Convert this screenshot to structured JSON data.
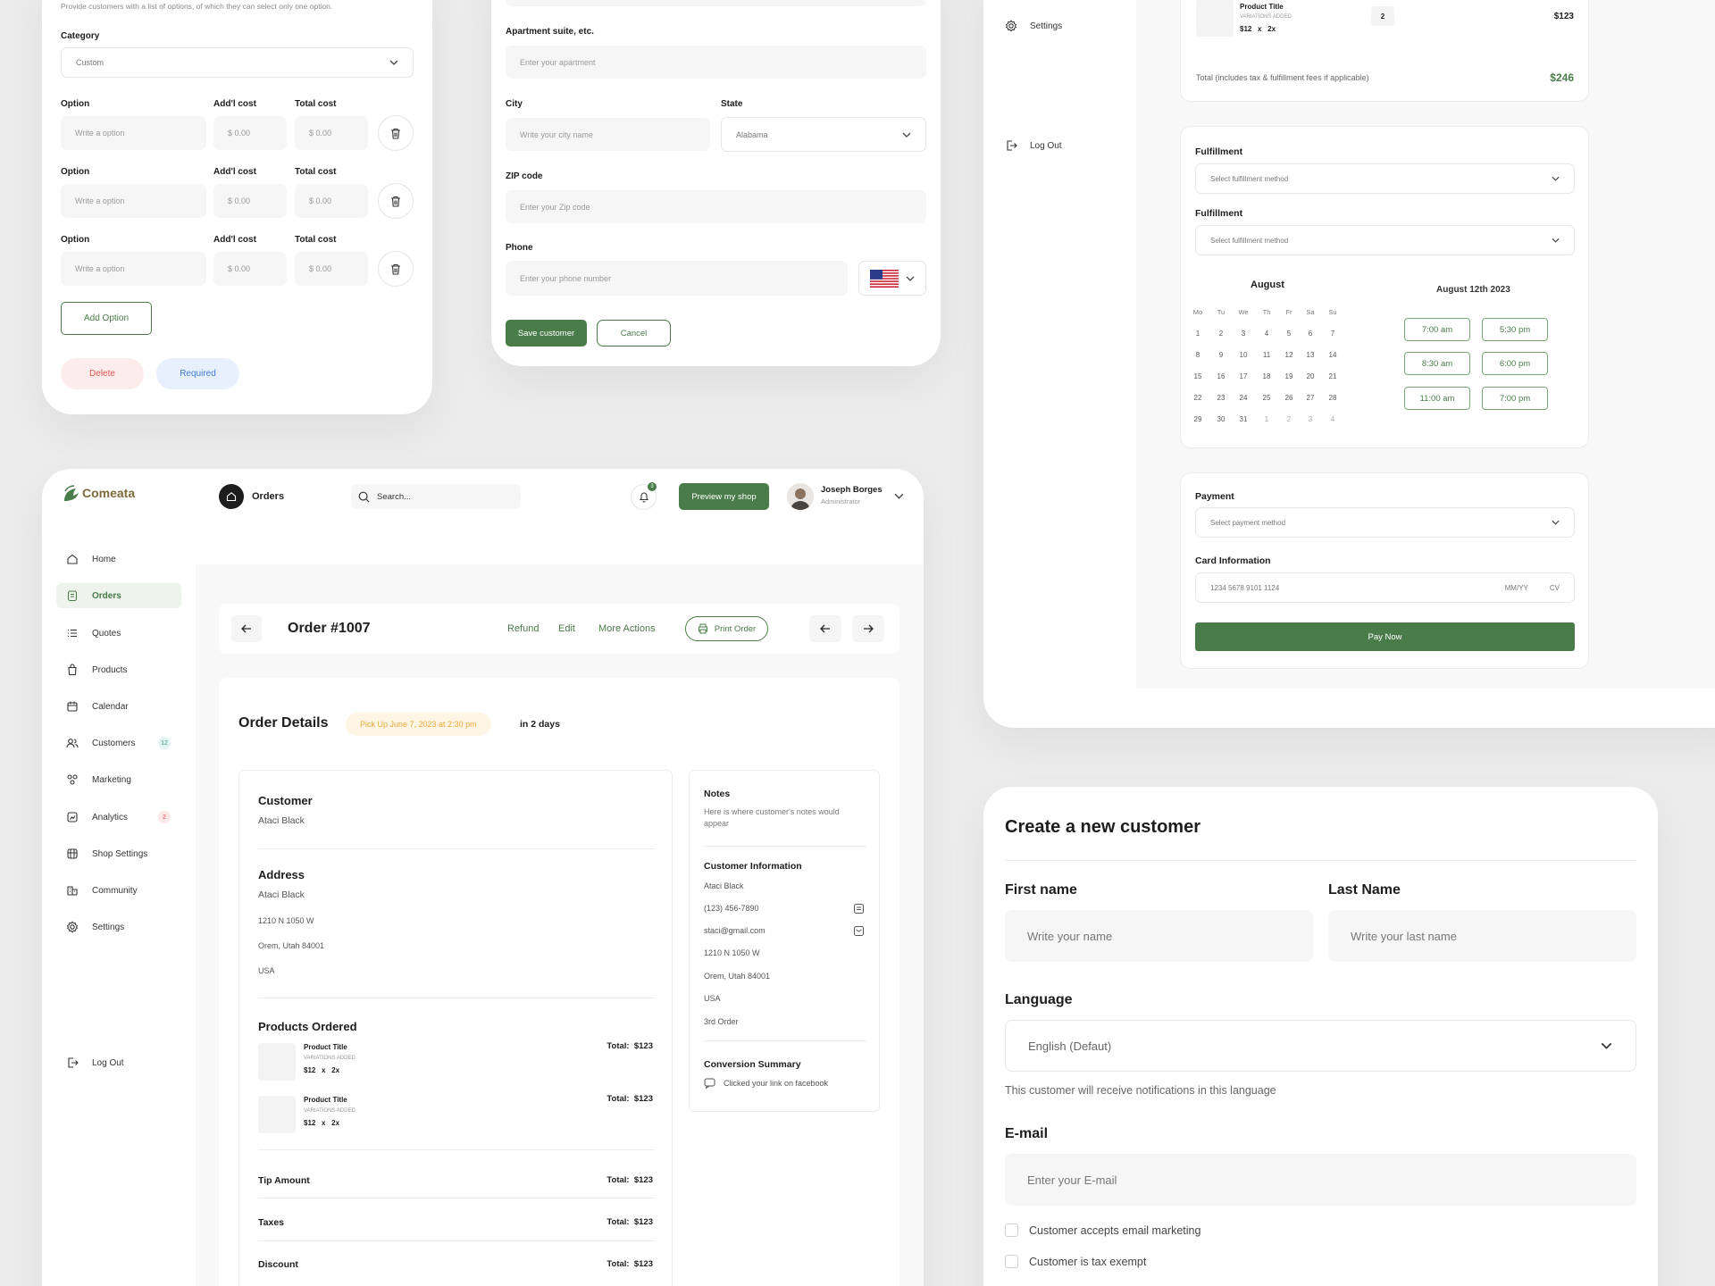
{
  "options_card": {
    "intro": "Provide customers with a list of options, of which they can select only one option.",
    "category_label": "Category",
    "category_value": "Custom",
    "headers": {
      "option": "Option",
      "addl": "Add'l cost",
      "total": "Total cost"
    },
    "rows": [
      {
        "option_placeholder": "Write a option",
        "addl": "$ 0.00",
        "total": "$ 0.00"
      },
      {
        "option_placeholder": "Write a option",
        "addl": "$ 0.00",
        "total": "$ 0.00"
      },
      {
        "option_placeholder": "Write a option",
        "addl": "$ 0.00",
        "total": "$ 0.00"
      }
    ],
    "add_option": "Add Option",
    "delete": "Delete",
    "required": "Required",
    "colors": {
      "delete_bg": "#fdecec",
      "delete_text": "#e65353",
      "required_bg": "#e8f0fd",
      "required_text": "#3f7ad9"
    }
  },
  "address_card": {
    "apt_label": "Apartment suite, etc.",
    "apt_placeholder": "Enter your apartment",
    "city_label": "City",
    "city_placeholder": "Write your city name",
    "state_label": "State",
    "state_value": "Alabama",
    "zip_label": "ZIP code",
    "zip_placeholder": "Enter your Zip code",
    "phone_label": "Phone",
    "phone_placeholder": "Enter your phone number",
    "flag_icon": "us-flag-icon",
    "save": "Save customer",
    "cancel": "Cancel"
  },
  "checkout_card": {
    "side_settings": "Settings",
    "side_logout": "Log Out",
    "product": {
      "title": "Product Title",
      "variation": "VARIATIONS ADDED",
      "price": "$12",
      "x": "x",
      "qty": "2x",
      "badge": "2",
      "total": "$123"
    },
    "total_label": "Total (includes tax & fulfillment fees if applicable)",
    "total_value": "$246",
    "fulfillment_label_1": "Fulfillment",
    "fulfillment_placeholder_1": "Select fulfillment method",
    "fulfillment_label_2": "Fulfillment",
    "fulfillment_placeholder_2": "Select fulfillment method",
    "month": "August",
    "weekdays": [
      "Mo",
      "Tu",
      "We",
      "Th",
      "Fr",
      "Sa",
      "Su"
    ],
    "days": [
      "1",
      "2",
      "3",
      "4",
      "5",
      "6",
      "7",
      "8",
      "9",
      "10",
      "11",
      "12",
      "13",
      "14",
      "15",
      "16",
      "17",
      "18",
      "19",
      "20",
      "21",
      "22",
      "23",
      "24",
      "25",
      "26",
      "27",
      "28",
      "29",
      "30",
      "31",
      "1",
      "2",
      "3",
      "4"
    ],
    "selected_date": "August 12th 2023",
    "slots": [
      "7:00 am",
      "5:30 pm",
      "8:30 am",
      "6:00 pm",
      "11:00 am",
      "7:00 pm"
    ],
    "payment_label": "Payment",
    "payment_placeholder": "Select payment method",
    "card_label": "Card Information",
    "card_number": "1234 5678 9101 1124",
    "card_mmyy": "MM/YY",
    "card_cv": "CV",
    "pay_now": "Pay Now"
  },
  "app": {
    "brand": "Comeata",
    "page_title": "Orders",
    "search_placeholder": "Search...",
    "notif_count": "3",
    "preview_button": "Preview my shop",
    "user_name": "Joseph Borges",
    "user_role": "Administrator",
    "sidebar": [
      {
        "label": "Home",
        "icon": "home-icon"
      },
      {
        "label": "Orders",
        "icon": "orders-icon"
      },
      {
        "label": "Quotes",
        "icon": "quotes-icon"
      },
      {
        "label": "Products",
        "icon": "bag-icon"
      },
      {
        "label": "Calendar",
        "icon": "calendar-icon"
      },
      {
        "label": "Customers",
        "icon": "users-icon",
        "badge": "12"
      },
      {
        "label": "Marketing",
        "icon": "marketing-icon"
      },
      {
        "label": "Analytics",
        "icon": "analytics-icon",
        "badge": "2"
      },
      {
        "label": "Shop Settings",
        "icon": "shop-icon"
      },
      {
        "label": "Community",
        "icon": "community-icon"
      },
      {
        "label": "Settings",
        "icon": "gear-icon"
      }
    ],
    "logout": "Log Out",
    "order": {
      "title": "Order #1007",
      "refund": "Refund",
      "edit": "Edit",
      "more_actions": "More Actions",
      "print": "Print Order",
      "details_title": "Order Details",
      "pickup": "Pick Up June 7, 2023 at 2:30 pm",
      "in_days": "in 2 days",
      "customer_heading": "Customer",
      "customer_name": "Ataci Black",
      "address_heading": "Address",
      "address_name": "Ataci Black",
      "address_line1": "1210 N 1050 W",
      "address_line2": "Orem, Utah 84001",
      "address_country": "USA",
      "products_heading": "Products Ordered",
      "products": [
        {
          "title": "Product Title",
          "variation": "VARIATIONS ADDED",
          "price": "$12",
          "x": "x",
          "qty": "2x",
          "total_label": "Total:",
          "total": "$123"
        },
        {
          "title": "Product Title",
          "variation": "VARIATIONS ADDED",
          "price": "$12",
          "x": "x",
          "qty": "2x",
          "total_label": "Total:",
          "total": "$123"
        }
      ],
      "tip_label": "Tip Amount",
      "tip_total_label": "Total:",
      "tip_total": "$123",
      "taxes_label": "Taxes",
      "taxes_total_label": "Total:",
      "taxes_total": "$123",
      "discount_label": "Discount",
      "discount_total_label": "Total:",
      "discount_total": "$123",
      "notes_heading": "Notes",
      "notes_text": "Here is where customer's notes would appear",
      "info_heading": "Customer Information",
      "info_name": "Ataci Black",
      "info_phone": "(123) 456-7890",
      "info_email": "staci@gmail.com",
      "info_line1": "1210 N 1050 W",
      "info_line2": "Orem, Utah 84001",
      "info_country": "USA",
      "info_orders": "3rd Order",
      "conversion_heading": "Conversion Summary",
      "conversion_text": "Clicked your link on facebook"
    },
    "colors": {
      "pickup_bg": "#fff5e4",
      "pickup_text": "#e8a93a",
      "badge_teal_bg": "#e3f4f1",
      "badge_teal_text": "#2d9a86",
      "badge_red_bg": "#fde8e8",
      "badge_red_text": "#e04a4a"
    }
  },
  "new_customer": {
    "title": "Create a new customer",
    "first_label": "First name",
    "first_placeholder": "Write your name",
    "last_label": "Last Name",
    "last_placeholder": "Write your last name",
    "language_label": "Language",
    "language_value": "English (Defaut)",
    "language_hint": "This customer will receive notifications in this language",
    "email_label": "E-mail",
    "email_placeholder": "Enter your E-mail",
    "check_marketing": "Customer accepts email marketing",
    "check_tax": "Customer is tax exempt"
  }
}
